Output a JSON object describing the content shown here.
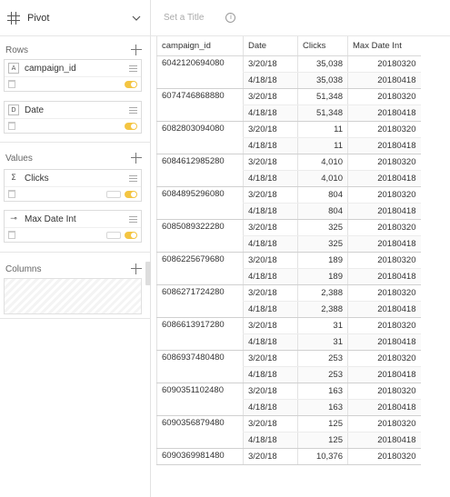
{
  "pivot": {
    "title": "Pivot"
  },
  "rows_section": {
    "label": "Rows",
    "fields": [
      {
        "type_badge": "A",
        "name": "campaign_id"
      },
      {
        "type_badge": "D",
        "name": "Date"
      }
    ]
  },
  "values_section": {
    "label": "Values",
    "fields": [
      {
        "type_badge": "Σ",
        "name": "Clicks"
      },
      {
        "type_badge": "⊸",
        "name": "Max Date Int"
      }
    ]
  },
  "columns_section": {
    "label": "Columns"
  },
  "header": {
    "set_title": "Set a Title",
    "info": "i"
  },
  "table": {
    "columns": [
      "campaign_id",
      "Date",
      "Clicks",
      "Max Date Int"
    ],
    "groups": [
      {
        "campaign_id": "6042120694080",
        "rows": [
          [
            "3/20/18",
            "35,038",
            "20180320"
          ],
          [
            "4/18/18",
            "35,038",
            "20180418"
          ]
        ]
      },
      {
        "campaign_id": "6074746868880",
        "rows": [
          [
            "3/20/18",
            "51,348",
            "20180320"
          ],
          [
            "4/18/18",
            "51,348",
            "20180418"
          ]
        ]
      },
      {
        "campaign_id": "6082803094080",
        "rows": [
          [
            "3/20/18",
            "11",
            "20180320"
          ],
          [
            "4/18/18",
            "11",
            "20180418"
          ]
        ]
      },
      {
        "campaign_id": "6084612985280",
        "rows": [
          [
            "3/20/18",
            "4,010",
            "20180320"
          ],
          [
            "4/18/18",
            "4,010",
            "20180418"
          ]
        ]
      },
      {
        "campaign_id": "6084895296080",
        "rows": [
          [
            "3/20/18",
            "804",
            "20180320"
          ],
          [
            "4/18/18",
            "804",
            "20180418"
          ]
        ]
      },
      {
        "campaign_id": "6085089322280",
        "rows": [
          [
            "3/20/18",
            "325",
            "20180320"
          ],
          [
            "4/18/18",
            "325",
            "20180418"
          ]
        ]
      },
      {
        "campaign_id": "6086225679680",
        "rows": [
          [
            "3/20/18",
            "189",
            "20180320"
          ],
          [
            "4/18/18",
            "189",
            "20180418"
          ]
        ]
      },
      {
        "campaign_id": "6086271724280",
        "rows": [
          [
            "3/20/18",
            "2,388",
            "20180320"
          ],
          [
            "4/18/18",
            "2,388",
            "20180418"
          ]
        ]
      },
      {
        "campaign_id": "6086613917280",
        "rows": [
          [
            "3/20/18",
            "31",
            "20180320"
          ],
          [
            "4/18/18",
            "31",
            "20180418"
          ]
        ]
      },
      {
        "campaign_id": "6086937480480",
        "rows": [
          [
            "3/20/18",
            "253",
            "20180320"
          ],
          [
            "4/18/18",
            "253",
            "20180418"
          ]
        ]
      },
      {
        "campaign_id": "6090351102480",
        "rows": [
          [
            "3/20/18",
            "163",
            "20180320"
          ],
          [
            "4/18/18",
            "163",
            "20180418"
          ]
        ]
      },
      {
        "campaign_id": "6090356879480",
        "rows": [
          [
            "3/20/18",
            "125",
            "20180320"
          ],
          [
            "4/18/18",
            "125",
            "20180418"
          ]
        ]
      },
      {
        "campaign_id": "6090369981480",
        "rows": [
          [
            "3/20/18",
            "10,376",
            "20180320"
          ]
        ]
      }
    ]
  },
  "colors": {
    "accent_toggle": "#f4c542",
    "border": "#e2e2e2"
  }
}
